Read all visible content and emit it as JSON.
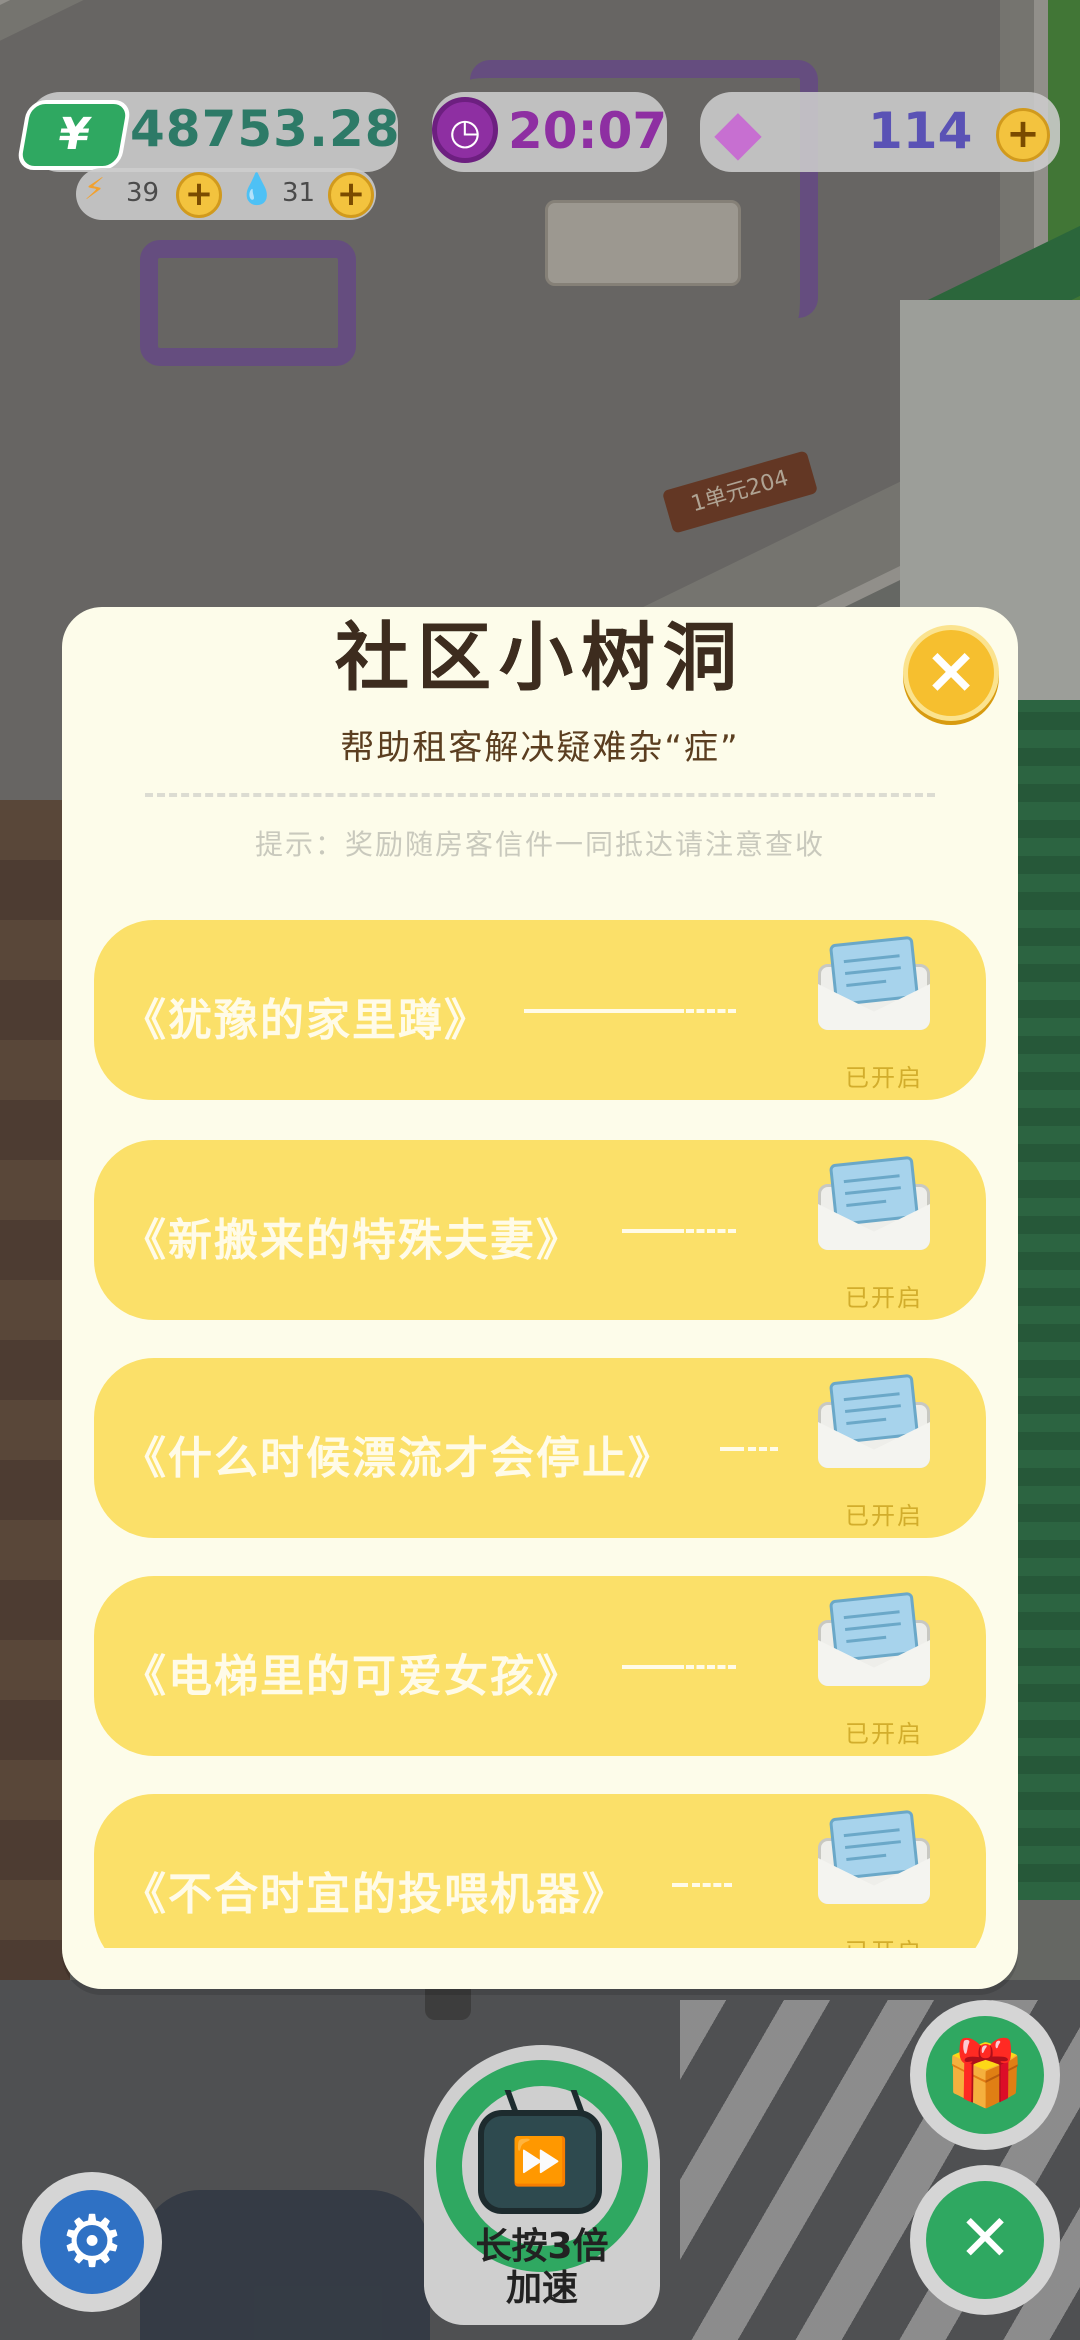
{
  "hud": {
    "money_symbol": "¥",
    "money": "48753.28",
    "energy": "39",
    "water": "31",
    "time": "20:07",
    "gems": "114",
    "plus": "+"
  },
  "scene": {
    "unit_sign": "1单元204"
  },
  "modal": {
    "title": "社区小树洞",
    "subtitle": "帮助租客解决疑难杂“症”",
    "hint": "提示：奖励随房客信件一同抵达请注意查收",
    "close": "×",
    "stories": [
      {
        "title": "《犹豫的家里蹲》",
        "status": "已开启"
      },
      {
        "title": "《新搬来的特殊夫妻》",
        "status": "已开启"
      },
      {
        "title": "《什么时候漂流才会停止》",
        "status": "已开启"
      },
      {
        "title": "《电梯里的可爱女孩》",
        "status": "已开启"
      },
      {
        "title": "《不合时宜的投喂机器》",
        "status": "已开启"
      }
    ]
  },
  "controls": {
    "speed_label_line1": "长按3倍",
    "speed_label_line2": "加速"
  },
  "icons": {
    "money": "yuan-icon",
    "energy": "bolt-icon",
    "water": "drop-icon",
    "time": "clock-icon",
    "gems": "gem-icon",
    "settings": "gear-icon",
    "speed": "tv-fast-forward-icon",
    "gift": "gift-icon",
    "tools": "tools-icon"
  },
  "colors": {
    "card": "#fbe069",
    "modal_bg": "#fdfcea",
    "accent_green": "#2fa861",
    "close_yellow": "#f6bf2f"
  }
}
